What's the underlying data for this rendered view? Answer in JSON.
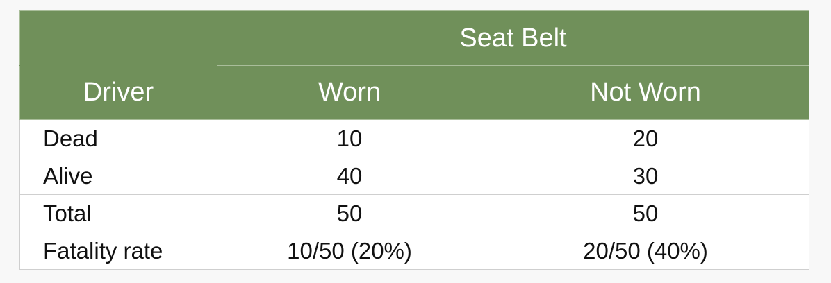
{
  "table": {
    "header_group": "Seat Belt",
    "row_header": "Driver",
    "columns": [
      "Worn",
      "Not Worn"
    ],
    "rows": [
      {
        "label": "Dead",
        "values": [
          "10",
          "20"
        ]
      },
      {
        "label": "Alive",
        "values": [
          "40",
          "30"
        ]
      },
      {
        "label": "Total",
        "values": [
          "50",
          "50"
        ]
      },
      {
        "label": "Fatality rate",
        "values": [
          "10/50 (20%)",
          "20/50 (40%)"
        ]
      }
    ]
  },
  "colors": {
    "header_background": "#70905a",
    "header_text": "#ffffff",
    "body_text": "#111111",
    "grid_line": "#cfcfcf"
  }
}
